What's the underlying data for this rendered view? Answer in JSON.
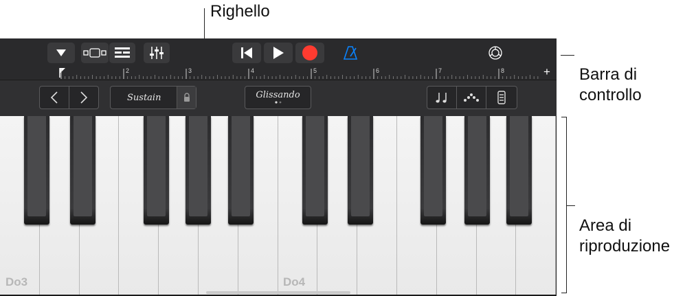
{
  "callouts": {
    "ruler": "Righello",
    "control_bar": "Barra di\ncontrollo",
    "play_area": "Area di\nriproduzione"
  },
  "toolbar": {
    "buttons": [
      "browser-dropdown",
      "tracks-view",
      "track-list",
      "mixer",
      "go-to-start",
      "play",
      "record",
      "metronome",
      "settings"
    ]
  },
  "ruler": {
    "marks": [
      "2",
      "3",
      "4",
      "5",
      "6",
      "7",
      "8"
    ],
    "add_label": "+"
  },
  "control_bar": {
    "sustain_label": "Sustain",
    "glissando_label": "Glissando"
  },
  "keyboard": {
    "labels": [
      "Do3",
      "Do4"
    ]
  },
  "colors": {
    "record": "#ff3b30",
    "metronome": "#0a84ff"
  }
}
